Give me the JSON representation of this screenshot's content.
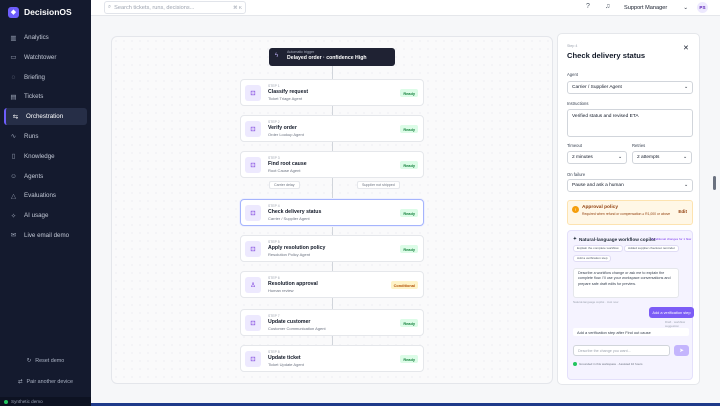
{
  "app": {
    "name": "DecisionOS",
    "logo_glyph": "◆"
  },
  "nav": [
    {
      "label": "Analytics",
      "icon": "chart-icon",
      "glyph": "▥",
      "active": false
    },
    {
      "label": "Watchtower",
      "icon": "monitor-icon",
      "glyph": "▭",
      "active": false
    },
    {
      "label": "Briefing",
      "icon": "bulb-icon",
      "glyph": "◌",
      "active": false
    },
    {
      "label": "Tickets",
      "icon": "ticket-icon",
      "glyph": "▤",
      "active": false
    },
    {
      "label": "Orchestration",
      "icon": "workflow-icon",
      "glyph": "⇆",
      "active": true
    },
    {
      "label": "Runs",
      "icon": "pulse-icon",
      "glyph": "∿",
      "active": false
    },
    {
      "label": "Knowledge",
      "icon": "book-icon",
      "glyph": "▯",
      "active": false
    },
    {
      "label": "Agents",
      "icon": "bot-icon",
      "glyph": "☺",
      "active": false
    },
    {
      "label": "Evaluations",
      "icon": "flask-icon",
      "glyph": "△",
      "active": false
    },
    {
      "label": "AI usage",
      "icon": "spark-icon",
      "glyph": "✧",
      "active": false
    },
    {
      "label": "Live email demo",
      "icon": "mail-icon",
      "glyph": "✉",
      "active": false
    }
  ],
  "sidebar_bottom": {
    "reset": "Reset demo",
    "pair": "Pair another device",
    "synthetic": "Synthetic demo"
  },
  "topbar": {
    "search_placeholder": "Search tickets, runs, decisions...",
    "shortcut": "⌘ K",
    "role": "Support Manager",
    "avatar": "PS"
  },
  "workflow": {
    "trigger": {
      "caption": "Automatic trigger",
      "title": "Delayed order · confidence High"
    },
    "steps": [
      {
        "caption": "STEP 1",
        "name": "Classify request",
        "agent": "Ticket Triage Agent",
        "status": "Ready",
        "icon": "bot-icon",
        "glyph": "⊡"
      },
      {
        "caption": "STEP 2",
        "name": "Verify order",
        "agent": "Order Lookup Agent",
        "status": "Ready",
        "icon": "bot-icon",
        "glyph": "⊡"
      },
      {
        "caption": "STEP 3",
        "name": "Find root cause",
        "agent": "Root Cause Agent",
        "status": "Ready",
        "icon": "bot-icon",
        "glyph": "⊡"
      },
      {
        "caption": "STEP 4",
        "name": "Check delivery status",
        "agent": "Carrier / Supplier Agent",
        "status": "Ready",
        "icon": "bot-icon",
        "glyph": "⊡"
      },
      {
        "caption": "STEP 5",
        "name": "Apply resolution policy",
        "agent": "Resolution Policy Agent",
        "status": "Ready",
        "icon": "bot-icon",
        "glyph": "⊡"
      },
      {
        "caption": "STEP 6",
        "name": "Resolution approval",
        "agent": "Human review",
        "status": "Conditional",
        "icon": "person-icon",
        "glyph": "♙"
      },
      {
        "caption": "STEP 7",
        "name": "Update customer",
        "agent": "Customer Communication Agent",
        "status": "Ready",
        "icon": "bot-icon",
        "glyph": "⊡"
      },
      {
        "caption": "STEP 8",
        "name": "Update ticket",
        "agent": "Ticket Update Agent",
        "status": "Ready",
        "icon": "bot-icon",
        "glyph": "⊡"
      }
    ],
    "branches": [
      "Carrier delay",
      "Supplier not shipped"
    ]
  },
  "panel": {
    "caption": "Step 4",
    "title": "Check delivery status",
    "agent_label": "Agent",
    "agent_value": "Carrier / Supplier Agent",
    "instructions_label": "Instructions",
    "instructions_value": "Verified status and revised ETA",
    "timeout_label": "Timeout",
    "timeout_value": "2 minutes",
    "retries_label": "Retries",
    "retries_value": "2 attempts",
    "failure_label": "On failure",
    "failure_value": "Pause and ask a human",
    "approval": {
      "title": "Approval policy",
      "desc": "Required when refund or compensation ≥ R1,000 or above",
      "edit": "Edit"
    },
    "copilot": {
      "title": "Natural-language workflow copilot",
      "status": "Conditional changes for 1 flow",
      "chips": [
        "Explain the complete workflow",
        "Added supplier checkout reminder",
        "Add a verification step"
      ],
      "assistant_msg": "Describe a workflow change or ask me to explain the complete flow. I'll use your workspace conversations and prepare safe draft edits for preview.",
      "assistant_meta": "Natural-language copilot · Just now",
      "user_msg": "Add a verification step",
      "user_meta": "Draft · workflow suggestion",
      "suggestion": "Add a verification step after Find out cause",
      "input_placeholder": "Describe the change you want...",
      "footer": "Grounded in this workspace · Assisted 10 hours"
    }
  }
}
